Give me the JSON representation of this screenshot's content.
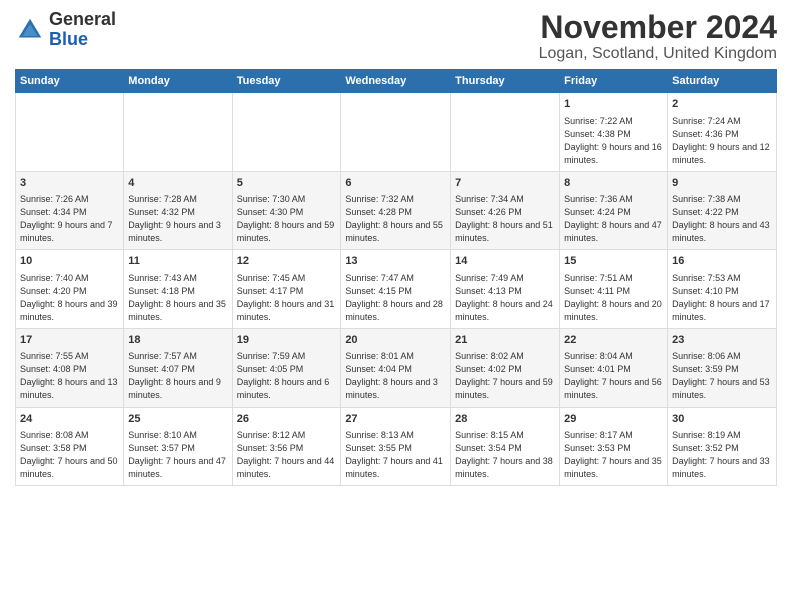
{
  "logo": {
    "general": "General",
    "blue": "Blue"
  },
  "title": "November 2024",
  "subtitle": "Logan, Scotland, United Kingdom",
  "headers": [
    "Sunday",
    "Monday",
    "Tuesday",
    "Wednesday",
    "Thursday",
    "Friday",
    "Saturday"
  ],
  "weeks": [
    [
      {
        "day": "",
        "info": ""
      },
      {
        "day": "",
        "info": ""
      },
      {
        "day": "",
        "info": ""
      },
      {
        "day": "",
        "info": ""
      },
      {
        "day": "",
        "info": ""
      },
      {
        "day": "1",
        "info": "Sunrise: 7:22 AM\nSunset: 4:38 PM\nDaylight: 9 hours and 16 minutes."
      },
      {
        "day": "2",
        "info": "Sunrise: 7:24 AM\nSunset: 4:36 PM\nDaylight: 9 hours and 12 minutes."
      }
    ],
    [
      {
        "day": "3",
        "info": "Sunrise: 7:26 AM\nSunset: 4:34 PM\nDaylight: 9 hours and 7 minutes."
      },
      {
        "day": "4",
        "info": "Sunrise: 7:28 AM\nSunset: 4:32 PM\nDaylight: 9 hours and 3 minutes."
      },
      {
        "day": "5",
        "info": "Sunrise: 7:30 AM\nSunset: 4:30 PM\nDaylight: 8 hours and 59 minutes."
      },
      {
        "day": "6",
        "info": "Sunrise: 7:32 AM\nSunset: 4:28 PM\nDaylight: 8 hours and 55 minutes."
      },
      {
        "day": "7",
        "info": "Sunrise: 7:34 AM\nSunset: 4:26 PM\nDaylight: 8 hours and 51 minutes."
      },
      {
        "day": "8",
        "info": "Sunrise: 7:36 AM\nSunset: 4:24 PM\nDaylight: 8 hours and 47 minutes."
      },
      {
        "day": "9",
        "info": "Sunrise: 7:38 AM\nSunset: 4:22 PM\nDaylight: 8 hours and 43 minutes."
      }
    ],
    [
      {
        "day": "10",
        "info": "Sunrise: 7:40 AM\nSunset: 4:20 PM\nDaylight: 8 hours and 39 minutes."
      },
      {
        "day": "11",
        "info": "Sunrise: 7:43 AM\nSunset: 4:18 PM\nDaylight: 8 hours and 35 minutes."
      },
      {
        "day": "12",
        "info": "Sunrise: 7:45 AM\nSunset: 4:17 PM\nDaylight: 8 hours and 31 minutes."
      },
      {
        "day": "13",
        "info": "Sunrise: 7:47 AM\nSunset: 4:15 PM\nDaylight: 8 hours and 28 minutes."
      },
      {
        "day": "14",
        "info": "Sunrise: 7:49 AM\nSunset: 4:13 PM\nDaylight: 8 hours and 24 minutes."
      },
      {
        "day": "15",
        "info": "Sunrise: 7:51 AM\nSunset: 4:11 PM\nDaylight: 8 hours and 20 minutes."
      },
      {
        "day": "16",
        "info": "Sunrise: 7:53 AM\nSunset: 4:10 PM\nDaylight: 8 hours and 17 minutes."
      }
    ],
    [
      {
        "day": "17",
        "info": "Sunrise: 7:55 AM\nSunset: 4:08 PM\nDaylight: 8 hours and 13 minutes."
      },
      {
        "day": "18",
        "info": "Sunrise: 7:57 AM\nSunset: 4:07 PM\nDaylight: 8 hours and 9 minutes."
      },
      {
        "day": "19",
        "info": "Sunrise: 7:59 AM\nSunset: 4:05 PM\nDaylight: 8 hours and 6 minutes."
      },
      {
        "day": "20",
        "info": "Sunrise: 8:01 AM\nSunset: 4:04 PM\nDaylight: 8 hours and 3 minutes."
      },
      {
        "day": "21",
        "info": "Sunrise: 8:02 AM\nSunset: 4:02 PM\nDaylight: 7 hours and 59 minutes."
      },
      {
        "day": "22",
        "info": "Sunrise: 8:04 AM\nSunset: 4:01 PM\nDaylight: 7 hours and 56 minutes."
      },
      {
        "day": "23",
        "info": "Sunrise: 8:06 AM\nSunset: 3:59 PM\nDaylight: 7 hours and 53 minutes."
      }
    ],
    [
      {
        "day": "24",
        "info": "Sunrise: 8:08 AM\nSunset: 3:58 PM\nDaylight: 7 hours and 50 minutes."
      },
      {
        "day": "25",
        "info": "Sunrise: 8:10 AM\nSunset: 3:57 PM\nDaylight: 7 hours and 47 minutes."
      },
      {
        "day": "26",
        "info": "Sunrise: 8:12 AM\nSunset: 3:56 PM\nDaylight: 7 hours and 44 minutes."
      },
      {
        "day": "27",
        "info": "Sunrise: 8:13 AM\nSunset: 3:55 PM\nDaylight: 7 hours and 41 minutes."
      },
      {
        "day": "28",
        "info": "Sunrise: 8:15 AM\nSunset: 3:54 PM\nDaylight: 7 hours and 38 minutes."
      },
      {
        "day": "29",
        "info": "Sunrise: 8:17 AM\nSunset: 3:53 PM\nDaylight: 7 hours and 35 minutes."
      },
      {
        "day": "30",
        "info": "Sunrise: 8:19 AM\nSunset: 3:52 PM\nDaylight: 7 hours and 33 minutes."
      }
    ]
  ]
}
